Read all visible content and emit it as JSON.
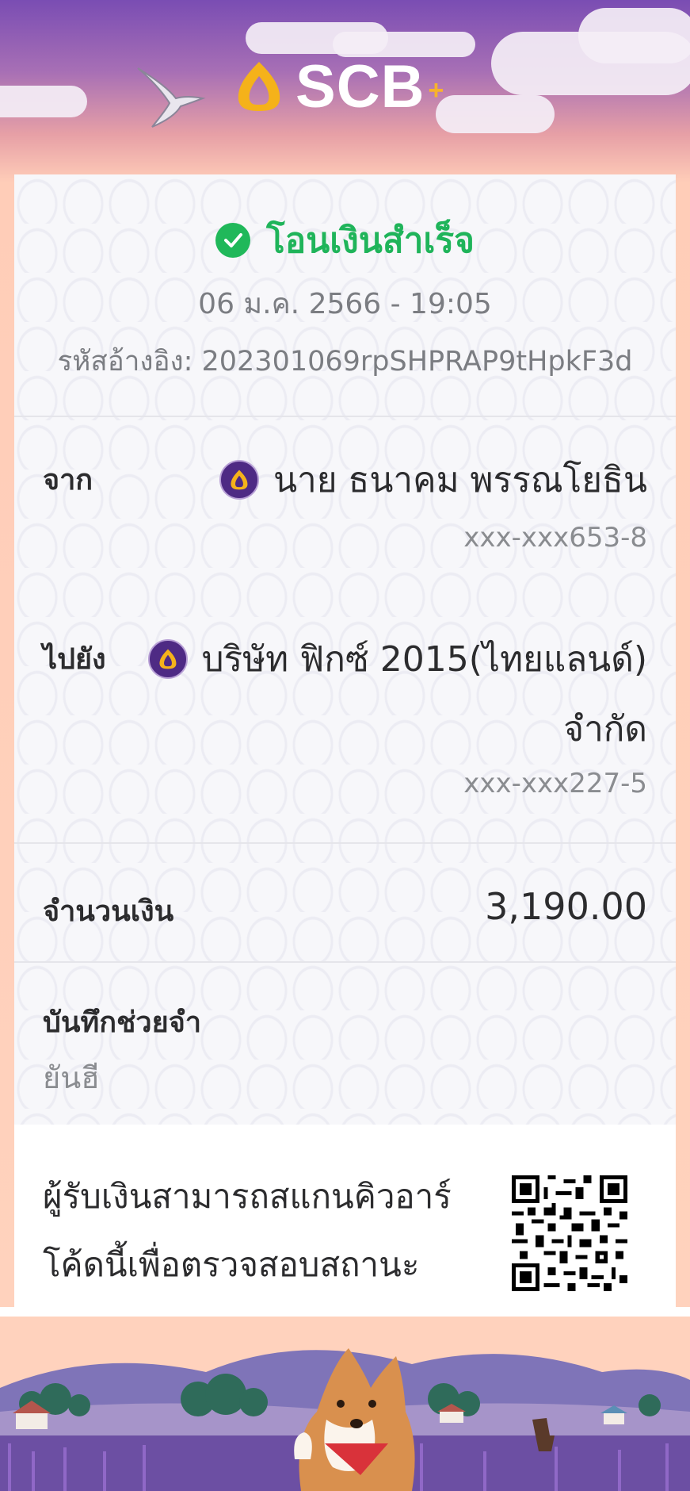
{
  "brand": {
    "name": "SCB",
    "plus": "+",
    "accent": "#f7b32b",
    "primary": "#4e2a84"
  },
  "status": {
    "icon": "check-circle-icon",
    "text": "โอนเงินสำเร็จ",
    "color": "#1fb45a"
  },
  "datetime": "06 ม.ค. 2566 - 19:05",
  "reference": "รหัสอ้างอิง: 202301069rpSHPRAP9tHpkF3d",
  "from": {
    "label": "จาก",
    "name": "นาย ธนาคม พรรณโยธิน",
    "account": "xxx-xxx653-8",
    "bank_icon": "scb-bank-icon"
  },
  "to": {
    "label": "ไปยัง",
    "name_line1": "บริษัท ฟิกซ์ 2015(ไทยแลนด์)",
    "name_line2": "จำกัด",
    "account": "xxx-xxx227-5",
    "bank_icon": "scb-bank-icon"
  },
  "amount": {
    "label": "จำนวนเงิน",
    "value": "3,190.00"
  },
  "memo": {
    "label": "บันทึกช่วยจำ",
    "value": "ยันฮี"
  },
  "qr": {
    "line1": "ผู้รับเงินสามารถสแกนคิวอาร์",
    "line2": "โค้ดนี้เพื่อตรวจสอบสถานะการ",
    "icon": "qr-code-icon"
  }
}
